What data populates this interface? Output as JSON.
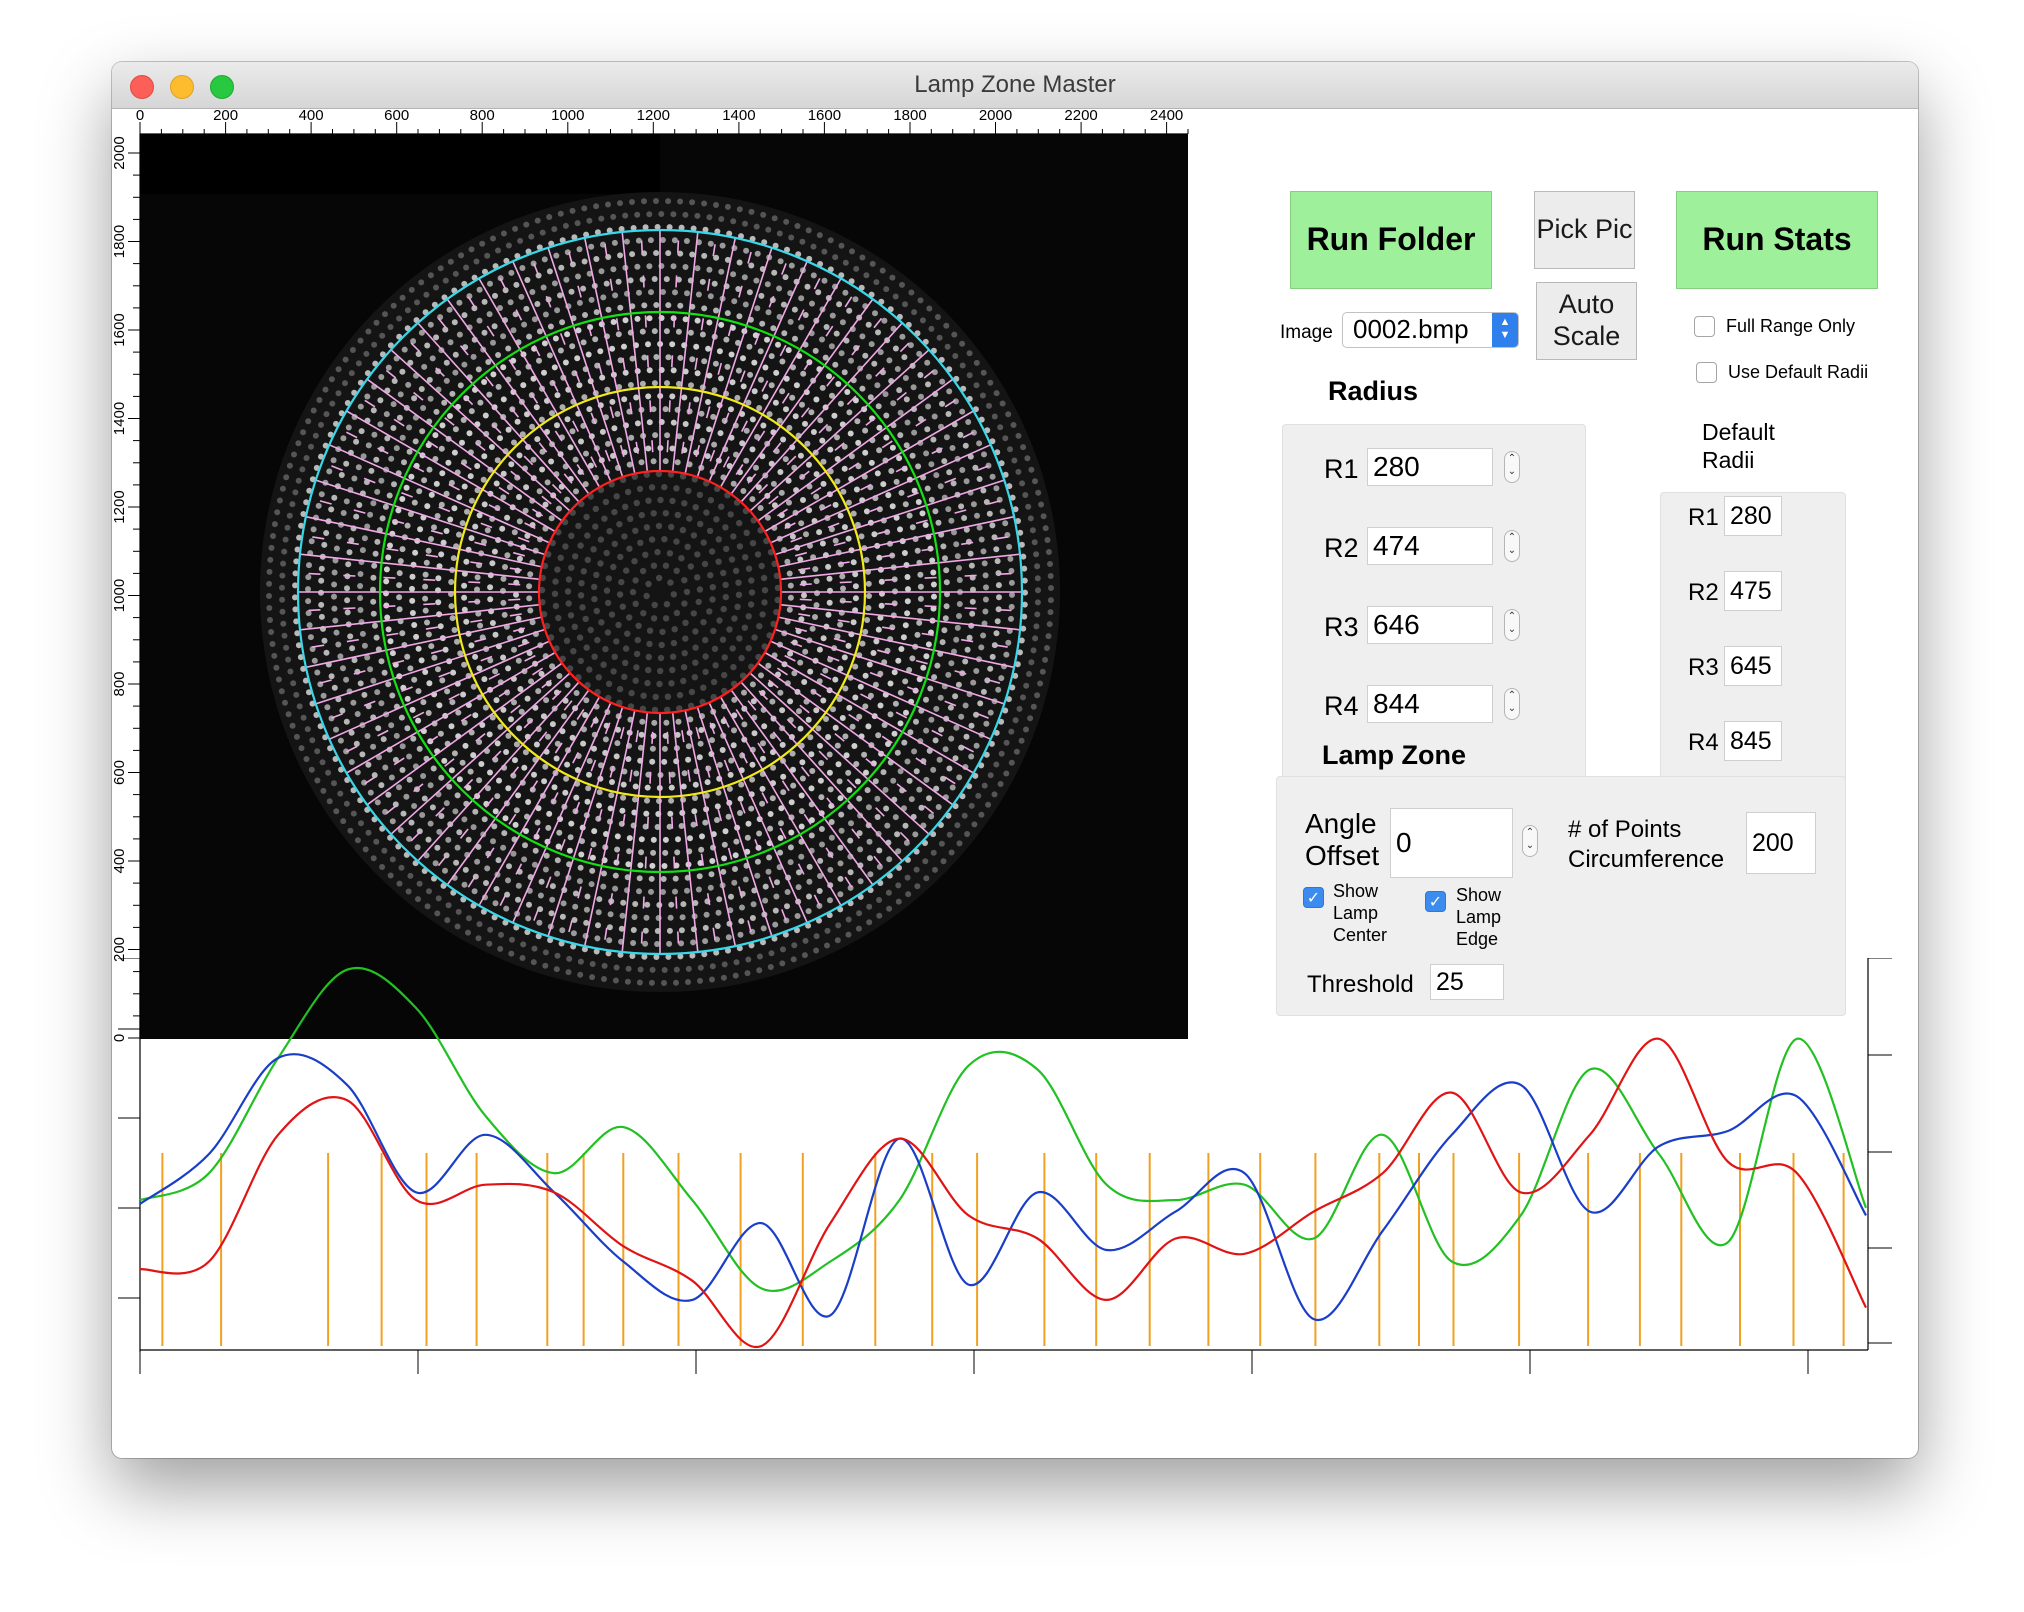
{
  "window": {
    "title": "Lamp Zone Master"
  },
  "image_view": {
    "x_ticks": [
      "0",
      "200",
      "400",
      "600",
      "800",
      "1000",
      "1200",
      "1400",
      "1600",
      "1800",
      "2000",
      "2200",
      "2400"
    ],
    "y_ticks": [
      "2000",
      "1800",
      "1600",
      "1400",
      "1200",
      "1000",
      "800",
      "600",
      "400",
      "200",
      "0"
    ],
    "ring_colors": [
      "#ff2020",
      "#f2ea1c",
      "#14e014",
      "#38d8e8"
    ],
    "spoke_color": "#f0a8e6",
    "spoke_count": 60
  },
  "controls": {
    "run_folder": "Run Folder",
    "pick_pic": "Pick Pic",
    "run_stats": "Run Stats",
    "auto_scale": "Auto Scale",
    "image_label": "Image",
    "image_value": "0002.bmp",
    "full_range_only": "Full Range Only",
    "use_default_radii": "Use Default Radii"
  },
  "radius": {
    "title": "Radius",
    "items": [
      {
        "label": "R1",
        "value": "280"
      },
      {
        "label": "R2",
        "value": "474"
      },
      {
        "label": "R3",
        "value": "646"
      },
      {
        "label": "R4",
        "value": "844"
      }
    ]
  },
  "default_radii": {
    "title_line1": "Default",
    "title_line2": "Radii",
    "items": [
      {
        "label": "R1",
        "value": "280"
      },
      {
        "label": "R2",
        "value": "475"
      },
      {
        "label": "R3",
        "value": "645"
      },
      {
        "label": "R4",
        "value": "845"
      }
    ]
  },
  "lamp_zone": {
    "title": "Lamp Zone",
    "angle_offset_line1": "Angle",
    "angle_offset_line2": "Offset",
    "angle_offset_value": "0",
    "points_label_line1": "# of Points",
    "points_label_line2": "Circumference",
    "points_value": "200",
    "show_lamp_center": [
      "Show",
      "Lamp",
      "Center"
    ],
    "show_lamp_edge": [
      "Show",
      "Lamp",
      "Edge"
    ],
    "threshold_label": "Threshold",
    "threshold_value": "25"
  },
  "chart_data": {
    "type": "line",
    "x": [
      0,
      4,
      8,
      12,
      16,
      20,
      24,
      28,
      32,
      36,
      40,
      44,
      48,
      52,
      56,
      60,
      64,
      68,
      72,
      76,
      80,
      84,
      88,
      92,
      96,
      100
    ],
    "series": [
      {
        "color": "#22c022",
        "values": [
          0.62,
          0.55,
          0.25,
          0.02,
          0.12,
          0.4,
          0.55,
          0.43,
          0.62,
          0.85,
          0.78,
          0.62,
          0.27,
          0.28,
          0.58,
          0.62,
          0.58,
          0.72,
          0.45,
          0.78,
          0.66,
          0.28,
          0.5,
          0.73,
          0.2,
          0.64
        ]
      },
      {
        "color": "#1a3ec8",
        "values": [
          0.63,
          0.5,
          0.25,
          0.32,
          0.6,
          0.45,
          0.6,
          0.78,
          0.88,
          0.68,
          0.92,
          0.46,
          0.84,
          0.6,
          0.75,
          0.65,
          0.55,
          0.93,
          0.7,
          0.45,
          0.32,
          0.65,
          0.48,
          0.44,
          0.35,
          0.66
        ]
      },
      {
        "color": "#e01414",
        "values": [
          0.8,
          0.78,
          0.45,
          0.36,
          0.62,
          0.58,
          0.6,
          0.74,
          0.83,
          1.0,
          0.68,
          0.46,
          0.66,
          0.72,
          0.88,
          0.72,
          0.76,
          0.65,
          0.55,
          0.34,
          0.6,
          0.45,
          0.2,
          0.52,
          0.55,
          0.9
        ]
      }
    ],
    "markers": [
      0.013,
      0.047,
      0.109,
      0.14,
      0.166,
      0.195,
      0.236,
      0.257,
      0.28,
      0.312,
      0.348,
      0.384,
      0.426,
      0.459,
      0.485,
      0.524,
      0.554,
      0.585,
      0.619,
      0.649,
      0.681,
      0.718,
      0.741,
      0.761,
      0.799,
      0.839,
      0.869,
      0.893,
      0.927,
      0.958,
      0.987
    ],
    "marker_color": "#f2a020"
  }
}
